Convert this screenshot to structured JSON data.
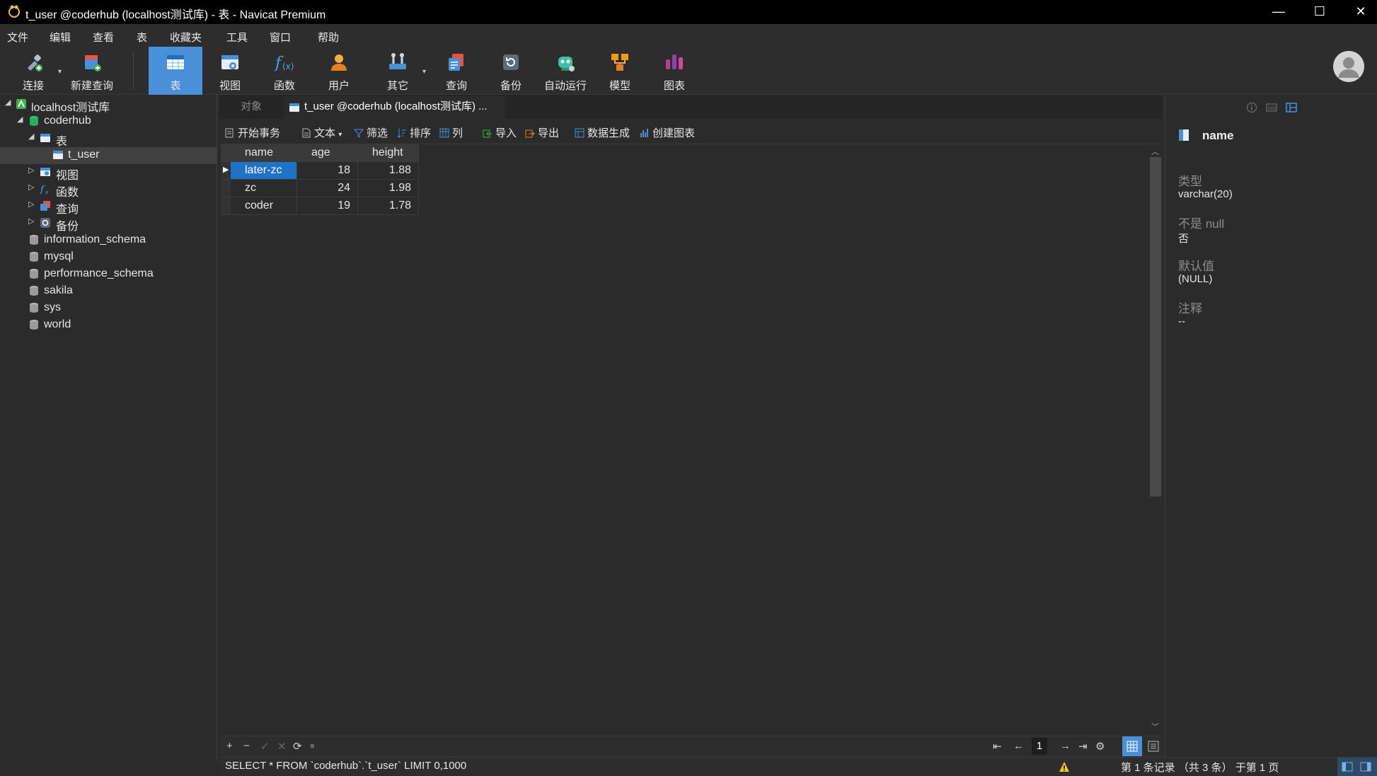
{
  "window": {
    "title": "t_user @coderhub (localhost测试库) - 表 - Navicat Premium"
  },
  "menu": [
    "文件",
    "编辑",
    "查看",
    "表",
    "收藏夹",
    "工具",
    "窗口",
    "帮助"
  ],
  "toolbar": {
    "connect": "连接",
    "new_query": "新建查询",
    "table": "表",
    "view": "视图",
    "function": "函数",
    "user": "用户",
    "other": "其它",
    "query": "查询",
    "backup": "备份",
    "automation": "自动运行",
    "model": "模型",
    "chart": "图表"
  },
  "navigator": {
    "connection": "localhost测试库",
    "database": "coderhub",
    "tables_folder": "表",
    "table": "t_user",
    "views_folder": "视图",
    "functions_folder": "函数",
    "queries_folder": "查询",
    "backups_folder": "备份",
    "other_databases": [
      "information_schema",
      "mysql",
      "performance_schema",
      "sakila",
      "sys",
      "world"
    ]
  },
  "tabs": {
    "objects": "对象",
    "active": "t_user @coderhub (localhost测试库) ..."
  },
  "subtoolbar": {
    "begin_transaction": "开始事务",
    "text": "文本",
    "filter": "筛选",
    "sort": "排序",
    "columns": "列",
    "import": "导入",
    "export": "导出",
    "data_generation": "数据生成",
    "create_chart": "创建图表"
  },
  "grid": {
    "columns": [
      "name",
      "age",
      "height"
    ],
    "rows": [
      [
        "later-zc",
        "18",
        "1.88"
      ],
      [
        "zc",
        "24",
        "1.98"
      ],
      [
        "coder",
        "19",
        "1.78"
      ]
    ]
  },
  "footer": {
    "add": "+",
    "remove": "−",
    "apply": "✓",
    "discard": "✕",
    "refresh": "⟳",
    "stop": "■",
    "first": "⇤",
    "prev": "←",
    "page": "1",
    "next": "→",
    "last": "⇥",
    "settings": "⚙"
  },
  "status": {
    "sql": "SELECT * FROM `coderhub`.`t_user` LIMIT 0,1000",
    "records": "第 1 条记录 （共 3 条） 于第 1 页"
  },
  "info_pane": {
    "field_name": "name",
    "type_label": "类型",
    "type_value": "varchar(20)",
    "not_null_label": "不是 null",
    "not_null_value": "否",
    "default_label": "默认值",
    "default_value": "(NULL)",
    "comment_label": "注释",
    "comment_value": "--"
  },
  "colors": {
    "accent": "#4a90d9",
    "selection": "#1e73c8",
    "background": "#2b2b2b",
    "header": "#3a3a3a"
  }
}
